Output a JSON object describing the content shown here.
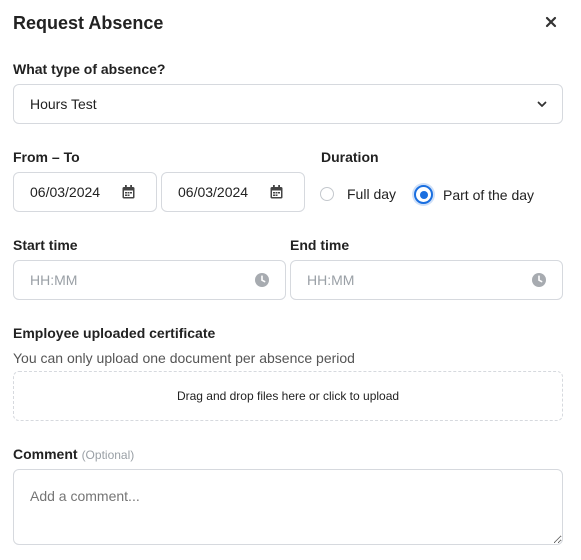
{
  "dialog": {
    "title": "Request Absence",
    "close_icon": "close-icon"
  },
  "absence_type": {
    "label": "What type of absence?",
    "value": "Hours Test",
    "icon": "chevron-down-icon"
  },
  "dates": {
    "label": "From – To",
    "from_value": "06/03/2024",
    "to_value": "06/03/2024",
    "icon": "calendar-icon"
  },
  "duration": {
    "label": "Duration",
    "options": [
      {
        "label": "Full day",
        "selected": false
      },
      {
        "label": "Part of the day",
        "selected": true
      }
    ]
  },
  "start_time": {
    "label": "Start time",
    "placeholder": "HH:MM",
    "icon": "clock-icon"
  },
  "end_time": {
    "label": "End time",
    "placeholder": "HH:MM",
    "icon": "clock-icon"
  },
  "certificate": {
    "label": "Employee uploaded certificate",
    "helper": "You can only upload one document per absence period",
    "dropzone_text": "Drag and drop files here or click to upload"
  },
  "comment": {
    "label": "Comment",
    "optional": "(Optional)",
    "placeholder": "Add a comment..."
  },
  "colors": {
    "accent": "#1a6fe0",
    "border": "#d6d9de",
    "icon_gray": "#a7abb0"
  }
}
